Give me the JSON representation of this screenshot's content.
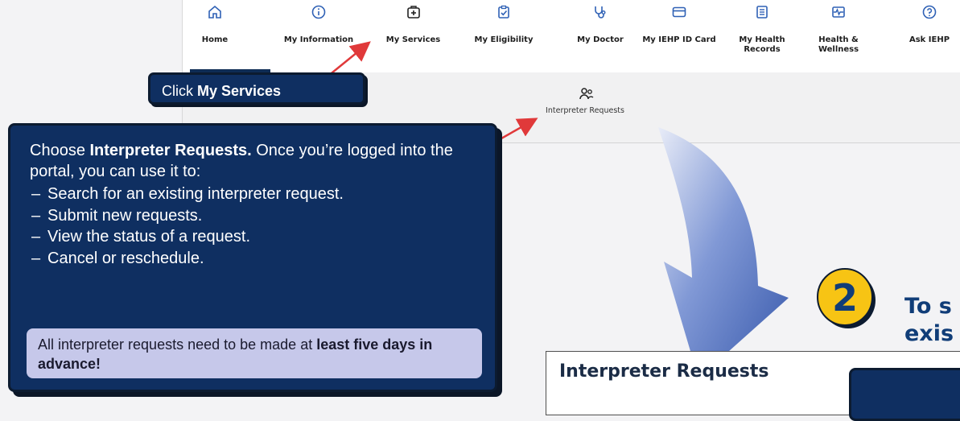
{
  "nav": {
    "items": [
      {
        "label": "Home",
        "icon": "home-icon"
      },
      {
        "label": "My Information",
        "icon": "info-icon"
      },
      {
        "label": "My Services",
        "icon": "medical-kit-icon"
      },
      {
        "label": "My Eligibility",
        "icon": "checklist-icon"
      },
      {
        "label": "My Doctor",
        "icon": "stethoscope-icon"
      },
      {
        "label": "My IEHP ID Card",
        "icon": "id-card-icon"
      },
      {
        "label": "My Health",
        "label2": "Records",
        "icon": "document-icon"
      },
      {
        "label": "Health &",
        "label2": "Wellness",
        "icon": "heart-pulse-icon"
      },
      {
        "label": "Ask IEHP",
        "icon": "help-icon"
      }
    ],
    "active": "My Services"
  },
  "subnav": {
    "label": "Interpreter Requests",
    "icon": "interpreter-people-icon"
  },
  "callout1": {
    "pre": "Click ",
    "bold": "My Services"
  },
  "callout2": {
    "intro_bold": "Choose ",
    "intro_strong": "Interpreter Requests.",
    "intro_rest": " Once you’re logged into the portal, you can use it to:",
    "items": [
      "Search for an existing interpreter request.",
      "Submit new requests.",
      "View the status of a request.",
      "Cancel or reschedule."
    ],
    "note_pre": "All interpreter requests need to be made at ",
    "note_bold": "least five days in advance!"
  },
  "step": {
    "number": "2",
    "line1": "To s",
    "line2": "exis"
  },
  "panel": {
    "title": "Interpreter Requests"
  },
  "colors": {
    "navy": "#0f2f61",
    "accent_yellow": "#f7c414",
    "note_bg": "#c6c8ea",
    "arrow_red": "#e0393a"
  }
}
